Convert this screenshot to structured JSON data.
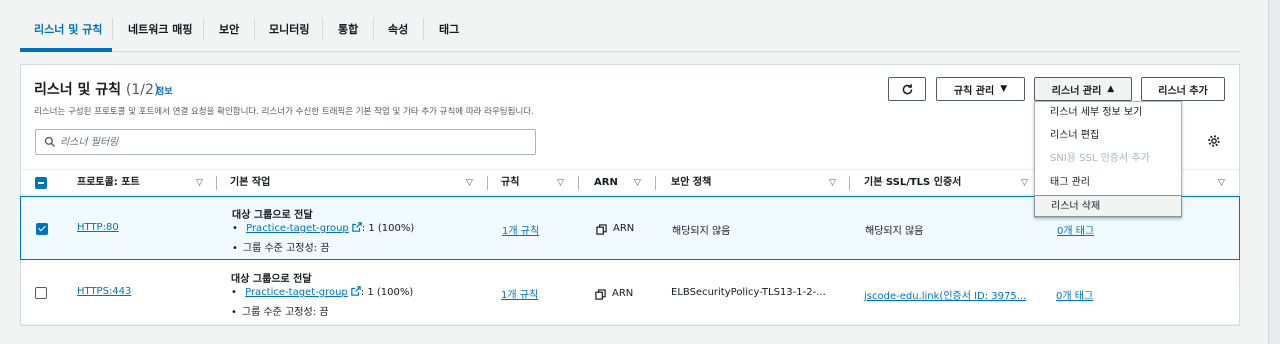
{
  "tabs": [
    "리스너 및 규칙",
    "네트워크 매핑",
    "보안",
    "모니터링",
    "통합",
    "속성",
    "태그"
  ],
  "panel": {
    "title": "리스너 및 규칙",
    "count": "(1/2)",
    "info": "정보",
    "description": "리스너는 구성된 프로토콜 및 포트에서 연결 요청을 확인합니다. 리스너가 수신한 트래픽은 기본 작업 및 기타 추가 규칙에 따라 라우팅됩니다."
  },
  "buttons": {
    "manage_rules": "규칙 관리",
    "manage_listener": "리스너 관리",
    "add_listener": "리스너 추가"
  },
  "search": {
    "placeholder": "리스너 필터링"
  },
  "columns": {
    "protocol_port": "프로토콜: 포트",
    "default_action": "기본 작업",
    "rules": "규칙",
    "arn": "ARN",
    "security_policy": "보안 정책",
    "default_ssl": "기본 SSL/TLS 인증서"
  },
  "rows": [
    {
      "selected": true,
      "protocol": "HTTP:80",
      "action_title": "대상 그룹으로 전달",
      "target_group": "Practice-taget-group",
      "weight": ": 1 (100%)",
      "stickiness": "그룹 수준 고정성: 끔",
      "rules": "1개 규칙",
      "arn": "ARN",
      "policy": "해당되지 않음",
      "ssl": "해당되지 않음",
      "tags": "0개 태그"
    },
    {
      "selected": false,
      "protocol": "HTTPS:443",
      "action_title": "대상 그룹으로 전달",
      "target_group": "Practice-taget-group",
      "weight": ": 1 (100%)",
      "stickiness": "그룹 수준 고정성: 끔",
      "rules": "1개 규칙",
      "arn": "ARN",
      "policy": "ELBSecurityPolicy-TLS13-1-2-...",
      "ssl": "jscode-edu.link(인증서 ID: 3975...",
      "tags": "0개 태그"
    }
  ],
  "dropdown": [
    "리스너 세부 정보 보기",
    "리스너 편집",
    "SNI용 SSL 인증서 추가",
    "태그 관리",
    "리스너 삭제"
  ],
  "colors": {
    "accent": "#0073bb",
    "text": "#16191f",
    "muted": "#545b64",
    "disabled": "#aab7b8"
  },
  "icons": [
    "refresh-icon",
    "search-icon",
    "gear-icon",
    "external-link-icon",
    "copy-icon",
    "caret-down-icon",
    "caret-up-icon",
    "chevron-right-icon"
  ]
}
